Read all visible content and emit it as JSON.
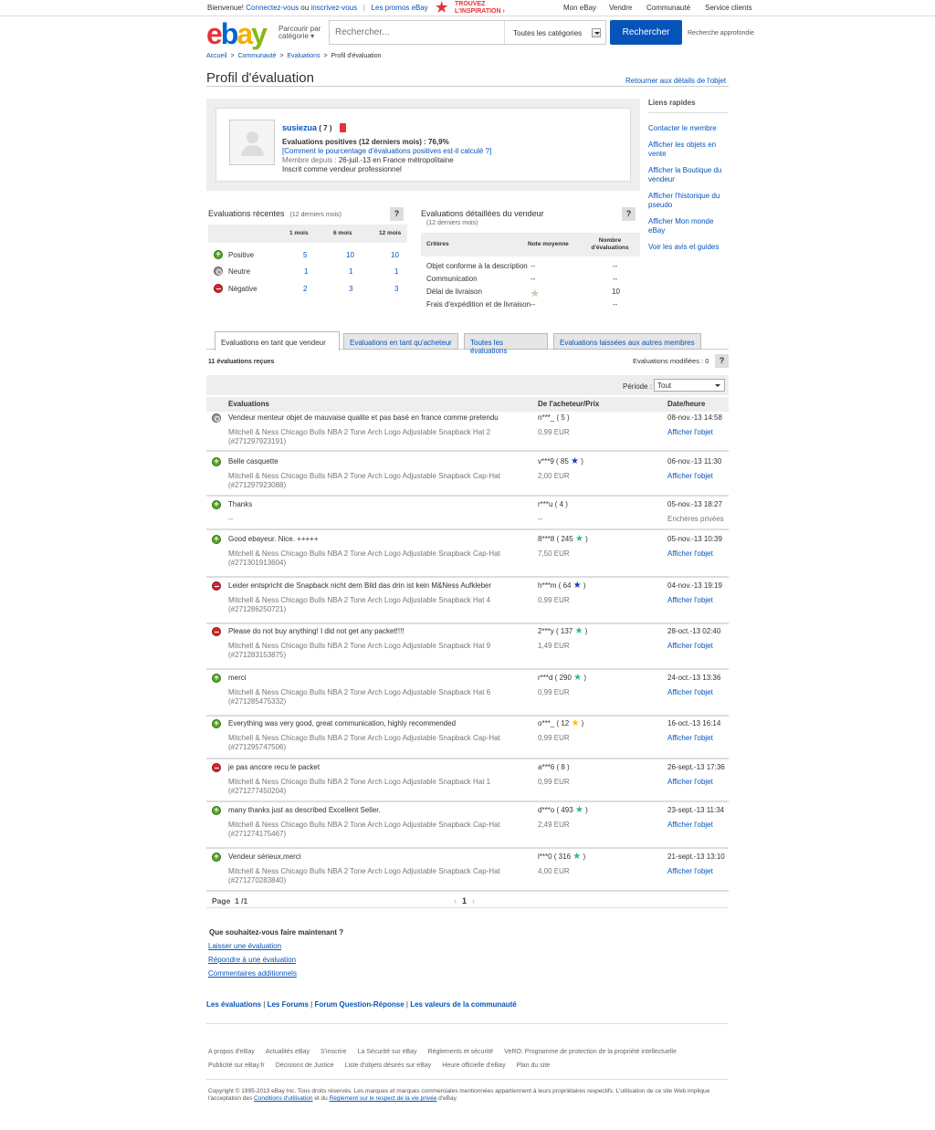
{
  "topbar": {
    "greeting": "Bienvenue!",
    "signin": "Connectez-vous",
    "or": " ou ",
    "register": "inscrivez-vous",
    "promos": "Les promos eBay",
    "inspire_line1": "TROUVEZ",
    "inspire_line2": "L'INSPIRATION",
    "my_ebay": "Mon eBay",
    "sell": "Vendre",
    "community": "Communauté",
    "customer_service": "Service clients"
  },
  "header": {
    "browse_line1": "Parcourir par",
    "browse_line2": "catégorie",
    "search_placeholder": "Rechercher...",
    "category": "Toutes les catégories",
    "search_button": "Rechercher",
    "advanced": "Recherche approfondie"
  },
  "breadcrumb": [
    "Accueil",
    "Communauté",
    "Evaluations",
    "Profil d'évaluation"
  ],
  "page": {
    "title": "Profil d'évaluation",
    "back_link": "Retourner aux détails de l'objet"
  },
  "quick_links": {
    "title": "Liens rapides",
    "items": [
      "Contacter le membre",
      "Afficher les objets en vente",
      "Afficher la Boutique du vendeur",
      "Afficher l'historique du pseudo",
      "Afficher Mon monde eBay",
      "Voir les avis et guides"
    ]
  },
  "profile": {
    "username": "susiezua",
    "score": "( 7 )",
    "positive_pct": "Evaluations positives (12 derniers mois) : 76,9%",
    "how_calc": "[Comment le pourcentage d'évaluations positives est-il calculé ?]",
    "member_since_label": "Membre depuis :",
    "member_since": "26-juil.-13 en France métropolitaine",
    "seller_type": "Inscrit comme vendeur professionnel"
  },
  "recent": {
    "title": "Evaluations récentes",
    "subtitle": "(12 derniers mois)",
    "help": "?",
    "columns": [
      "1 mois",
      "6 mois",
      "12 mois"
    ],
    "rows": [
      {
        "label": "Positive",
        "values": [
          "5",
          "10",
          "10"
        ]
      },
      {
        "label": "Neutre",
        "values": [
          "1",
          "1",
          "1"
        ]
      },
      {
        "label": "Négative",
        "values": [
          "2",
          "3",
          "3"
        ]
      }
    ]
  },
  "detailed": {
    "title": "Evaluations détaillées du vendeur",
    "subtitle": "(12 derniers mois)",
    "help": "?",
    "col_criteria": "Critères",
    "col_avg": "Note moyenne",
    "col_count_1": "Nombre",
    "col_count_2": "d'évaluations",
    "rows": [
      {
        "label": "Objet conforme à la description",
        "avg": "--",
        "count": "--"
      },
      {
        "label": "Communication",
        "avg": "--",
        "count": "--"
      },
      {
        "label": "Délai de livraison",
        "avg": "",
        "count": "10",
        "rating": 3.5
      },
      {
        "label": "Frais d'expédition et de livraison",
        "avg": "--",
        "count": "--"
      }
    ]
  },
  "tabs": [
    "Evaluations en tant que vendeur",
    "Evaluations en tant qu'acheteur",
    "Toutes les évaluations",
    "Evaluations laissées aux autres membres"
  ],
  "list": {
    "received": "11 évaluations reçues",
    "modified": "Evaluations modifiées : 0",
    "help": "?",
    "period_label": "Période :",
    "period_value": "Tout",
    "col_feedback": "Evaluations",
    "col_buyer": "De l'acheteur/Prix",
    "col_date": "Date/heure"
  },
  "feedback": [
    {
      "type": "neu",
      "comment": "Vendeur menteur objet de mauvaise qualite et pas basé en france comme pretendu",
      "item": "Mitchell & Ness Chicago Bulls NBA 2 Tone Arch Logo Adjustable Snapback Hat 2",
      "item_id": "(#271297923191)",
      "buyer": "n***_ ( 5 )",
      "star": "",
      "price": "0,99 EUR",
      "date": "08-nov.-13 14:58",
      "view": "Afficher l'objet"
    },
    {
      "type": "pos",
      "comment": "Belle casquette",
      "item": "Mitchell & Ness Chicago Bulls NBA 2 Tone Arch Logo Adjustable Snapback Cap-Hat",
      "item_id": "(#271297923088)",
      "buyer": "v***9 ( 85",
      "star": "blue",
      "price": "2,00 EUR",
      "date": "06-nov.-13 11:30",
      "view": "Afficher l'objet"
    },
    {
      "type": "pos",
      "comment": "Thanks",
      "item": "--",
      "item_id": "",
      "buyer": "r***u ( 4 )",
      "star": "",
      "price": "--",
      "date": "05-nov.-13 18:27",
      "view": "Enchères privées"
    },
    {
      "type": "pos",
      "comment": "Good ebayeur. Nice. +++++",
      "item": "Mitchell & Ness Chicago Bulls NBA 2 Tone Arch Logo Adjustable Snapback Cap-Hat",
      "item_id": "(#271301913604)",
      "buyer": "8***8 ( 245",
      "star": "teal",
      "price": "7,50 EUR",
      "date": "05-nov.-13 10:39",
      "view": "Afficher l'objet"
    },
    {
      "type": "neg",
      "comment": "Leider entspricht die Snapback nicht dem Bild das drin ist kein M&Ness Aufkleber",
      "item": "Mitchell & Ness Chicago Bulls NBA 2 Tone Arch Logo Adjustable Snapback Hat 4",
      "item_id": "(#271286250721)",
      "buyer": "h***m ( 64",
      "star": "blue",
      "price": "0,99 EUR",
      "date": "04-nov.-13 19:19",
      "view": "Afficher l'objet"
    },
    {
      "type": "neg",
      "comment": "Please do not buy anything! I did not get any packet!!!!",
      "item": "Mitchell & Ness Chicago Bulls NBA 2 Tone Arch Logo Adjustable Snapback Hat 9",
      "item_id": "(#271283153875)",
      "buyer": "2***y ( 137",
      "star": "teal",
      "price": "1,49 EUR",
      "date": "28-oct.-13 02:40",
      "view": "Afficher l'objet"
    },
    {
      "type": "pos",
      "comment": "merci",
      "item": "Mitchell & Ness Chicago Bulls NBA 2 Tone Arch Logo Adjustable Snapback Hat 6",
      "item_id": "(#271285475332)",
      "buyer": "r***d ( 290",
      "star": "teal",
      "price": "0,99 EUR",
      "date": "24-oct.-13 13:36",
      "view": "Afficher l'objet"
    },
    {
      "type": "pos",
      "comment": "Everything was very good, great communication, highly recommended",
      "item": "Mitchell & Ness Chicago Bulls NBA 2 Tone Arch Logo Adjustable Snapback Cap-Hat",
      "item_id": "(#271295747506)",
      "buyer": "o***_ ( 12",
      "star": "yellow",
      "price": "0,99 EUR",
      "date": "16-oct.-13 16:14",
      "view": "Afficher l'objet"
    },
    {
      "type": "neg",
      "comment": "je pas ancore recu le packet",
      "item": "Mitchell & Ness Chicago Bulls NBA 2 Tone Arch Logo Adjustable Snapback Hat 1",
      "item_id": "(#271277450204)",
      "buyer": "a***6 ( 8 )",
      "star": "",
      "price": "0,99 EUR",
      "date": "26-sept.-13 17:36",
      "view": "Afficher l'objet"
    },
    {
      "type": "pos",
      "comment": "many thanks just as described Excellent Seller.",
      "item": "Mitchell & Ness Chicago Bulls NBA 2 Tone Arch Logo Adjustable Snapback Cap-Hat",
      "item_id": "(#271274175467)",
      "buyer": "d***o ( 493",
      "star": "teal",
      "price": "2,49 EUR",
      "date": "23-sept.-13 11:34",
      "view": "Afficher l'objet"
    },
    {
      "type": "pos",
      "comment": "Vendeur sérieux,merci",
      "item": "Mitchell & Ness Chicago Bulls NBA 2 Tone Arch Logo Adjustable Snapback Cap-Hat",
      "item_id": "(#271270283840)",
      "buyer": "l***0 ( 316",
      "star": "teal",
      "price": "4,00 EUR",
      "date": "21-sept.-13 13:10",
      "view": "Afficher l'objet"
    }
  ],
  "pager": {
    "label": "Page",
    "current": "1",
    "total": "/1",
    "number": "1"
  },
  "next": {
    "question": "Que souhaitez-vous faire maintenant ?",
    "links": [
      "Laisser une évaluation",
      "Répondre à une évaluation",
      "Commentaires additionnels"
    ]
  },
  "community_links": [
    "Les évaluations",
    "Les Forums",
    "Forum Question-Réponse",
    "Les valeurs de la communauté"
  ],
  "footer": {
    "row1": [
      "A propos d'eBay",
      "Actualités eBay",
      "S'inscrire",
      "La Sécurité sur eBay",
      "Réglements et sécurité",
      "VeRO: Programme de protection de la propriété intellectuelle"
    ],
    "row2": [
      "Publicité sur eBay.fr",
      "Décisions de Justice",
      "Liste d'objets désirés sur eBay",
      "Heure officielle d'eBay",
      "Plan du site"
    ],
    "copyright_1": "Copyright © 1995-2013 eBay Inc. Tous droits réservés. Les marques et marques commerciales mentionnées appartiennent à leurs propriétaires respectifs. L'utilisation de ce site Web implique l'acceptation des ",
    "cgu": "Conditions d'utilisation",
    "copyright_2": " et du ",
    "privacy": "Règlement sur le respect de la vie privée",
    "copyright_3": " d'eBay."
  },
  "colors": {
    "link": "#0654ba",
    "positive": "#5ba829",
    "negative": "#d8262f",
    "neutral": "#999999",
    "star_blue": "#1f3fb4",
    "star_teal": "#2fb5a0",
    "star_yellow": "#f5c400"
  }
}
